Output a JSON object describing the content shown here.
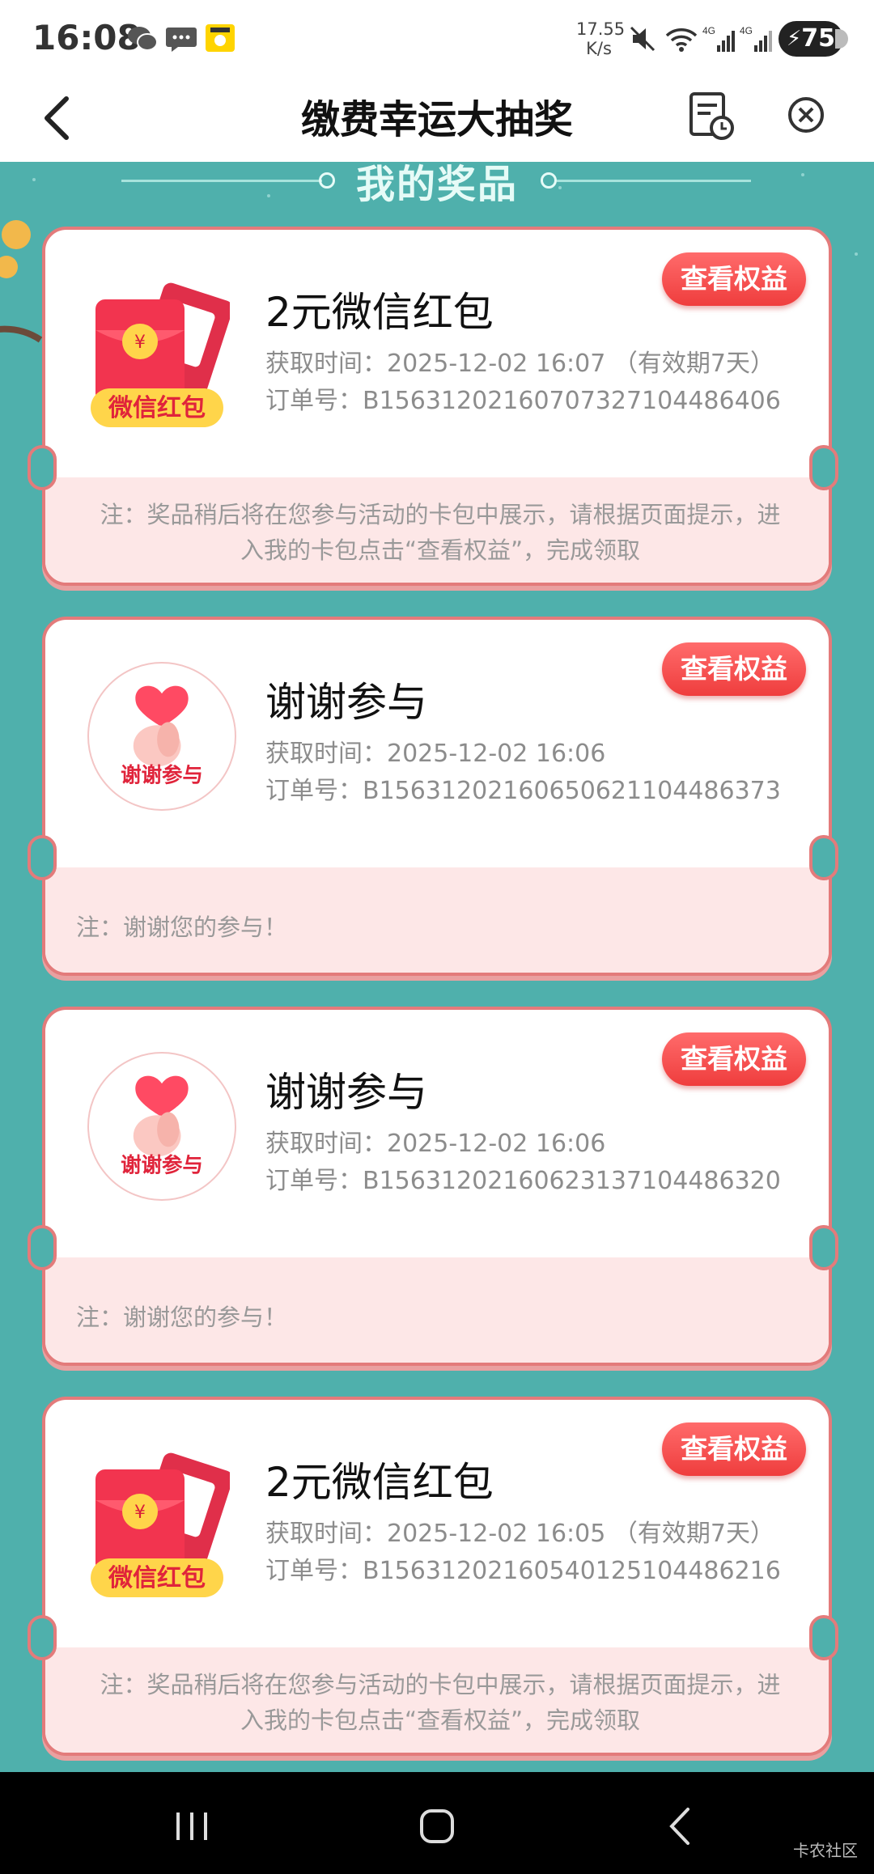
{
  "status_bar": {
    "time": "16:08",
    "net_speed_value": "17.55",
    "net_speed_unit": "K/s",
    "battery": "75"
  },
  "nav": {
    "title": "缴费幸运大抽奖"
  },
  "section": {
    "title": "我的奖品"
  },
  "cards": [
    {
      "prize": "2元微信红包",
      "badge": "微信红包",
      "time": "获取时间：2025-12-02 16:07 （有效期7天）",
      "order": "订单号：B15631202160707327104486406",
      "button": "查看权益",
      "note_line1": "注：奖品稍后将在您参与活动的卡包中展示，请根据页面提示，进",
      "note_line2": "入我的卡包点击“查看权益”，完成领取"
    },
    {
      "prize": "谢谢参与",
      "badge": "谢谢参与",
      "time": "获取时间：2025-12-02 16:06",
      "order": "订单号：B15631202160650621104486373",
      "button": "查看权益",
      "note": "注：谢谢您的参与！"
    },
    {
      "prize": "谢谢参与",
      "badge": "谢谢参与",
      "time": "获取时间：2025-12-02 16:06",
      "order": "订单号：B15631202160623137104486320",
      "button": "查看权益",
      "note": "注：谢谢您的参与！"
    },
    {
      "prize": "2元微信红包",
      "badge": "微信红包",
      "time": "获取时间：2025-12-02 16:05 （有效期7天）",
      "order": "订单号：B15631202160540125104486216",
      "button": "查看权益",
      "note_line1": "注：奖品稍后将在您参与活动的卡包中展示，请根据页面提示，进",
      "note_line2": "入我的卡包点击“查看权益”，完成领取"
    }
  ],
  "watermark": "卡农社区",
  "colors": {
    "background_teal": "#4fb0ac",
    "card_border": "#e37b7b",
    "note_bg": "#fde7e7",
    "button_red": "#ef3d3d"
  },
  "icons": {
    "back": "chevron-left-icon",
    "records": "record-clock-icon",
    "close": "close-circle-icon",
    "red_packet": "red-envelope-icon",
    "thanks": "heart-hand-icon"
  }
}
